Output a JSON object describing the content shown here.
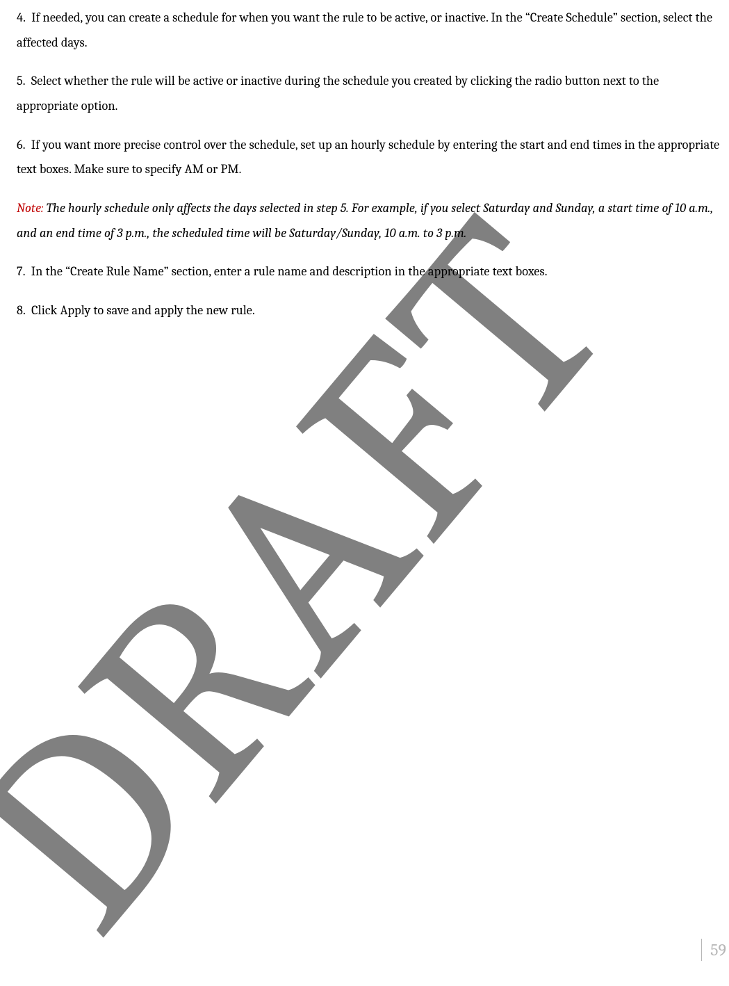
{
  "paragraphs": {
    "p4": "4.  If needed, you can create a schedule for when you want the rule to be active, or inactive. In the “Create Schedule” section, select the affected days.",
    "p5": "5.  Select whether the rule will be active or inactive during the schedule you created by clicking the radio button next to the appropriate option.",
    "p6": "6.  If you want more precise control over the schedule, set up an hourly schedule by entering the start and end times in the appropriate text boxes. Make sure to specify AM or PM.",
    "note_label": "Note:",
    "note_body": " The hourly schedule only affects the days selected in step 5. For example, if you select Saturday and Sunday, a start time of 10 a.m., and an end time of 3 p.m., the scheduled  time will be Saturday/Sunday, 10 a.m. to 3 p.m.",
    "p7": "7.  In the “Create Rule Name” section, enter a rule name and description in the appropriate text boxes.",
    "p8": "8.  Click Apply to save and apply the new rule."
  },
  "watermark": "DRAFT",
  "page_number": "59"
}
